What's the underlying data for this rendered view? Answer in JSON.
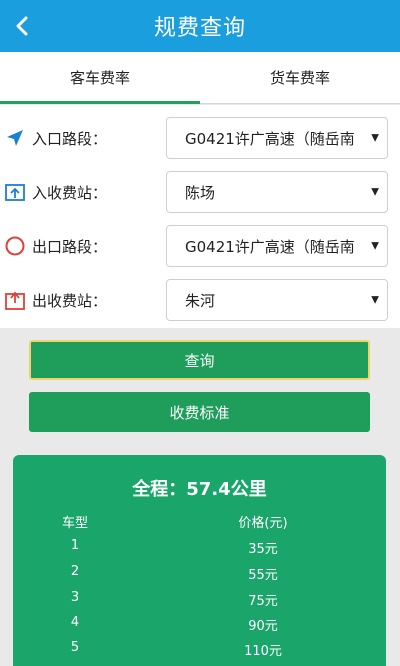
{
  "header": {
    "title": "规费查询"
  },
  "tabs": [
    {
      "label": "客车费率",
      "active": true
    },
    {
      "label": "货车费率",
      "active": false
    }
  ],
  "form": {
    "entry_road": {
      "label": "入口路段：",
      "value": "G0421许广高速（随岳南"
    },
    "entry_station": {
      "label": "入收费站：",
      "value": "陈场"
    },
    "exit_road": {
      "label": "出口路段：",
      "value": "G0421许广高速（随岳南"
    },
    "exit_station": {
      "label": "出收费站：",
      "value": "朱河"
    }
  },
  "buttons": {
    "query": "查询",
    "standard": "收费标准"
  },
  "result": {
    "distance": "全程：57.4公里",
    "col_type": "车型",
    "col_price": "价格(元)",
    "rows": [
      {
        "type": "1",
        "price": "35元"
      },
      {
        "type": "2",
        "price": "55元"
      },
      {
        "type": "3",
        "price": "75元"
      },
      {
        "type": "4",
        "price": "90元"
      },
      {
        "type": "5",
        "price": "110元"
      }
    ]
  },
  "colors": {
    "header_blue": "#1a9ede",
    "accent_green": "#1f9d5a",
    "result_green": "#1aa56a",
    "exit_red": "#e0403a",
    "icon_blue": "#1a7fd6"
  }
}
